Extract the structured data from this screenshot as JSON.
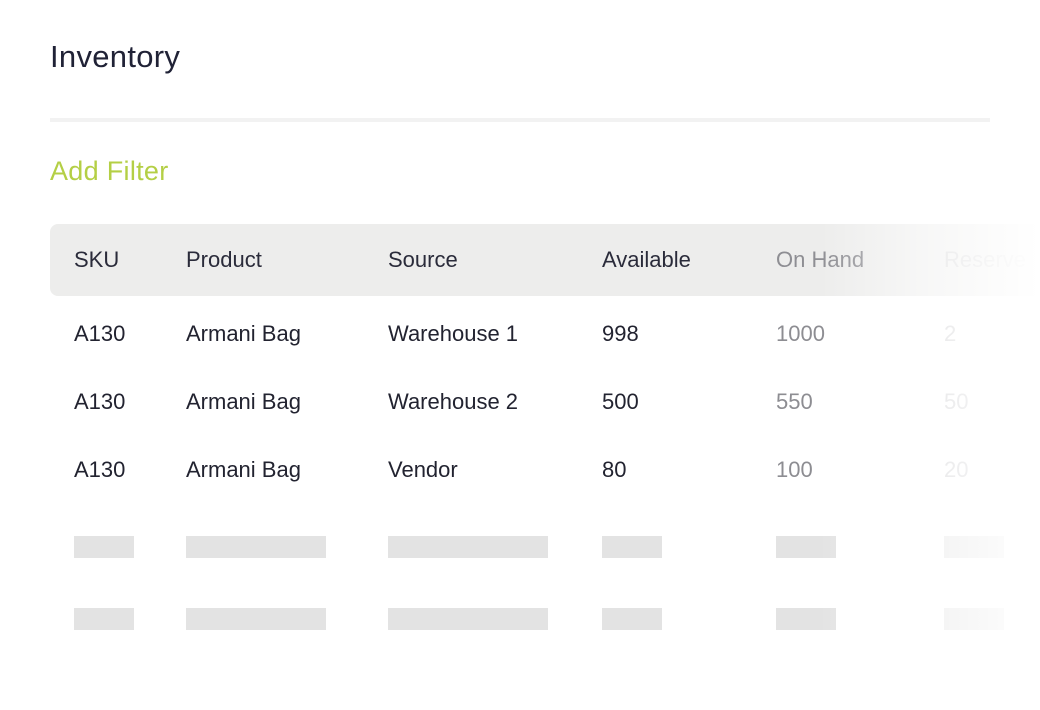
{
  "header": {
    "title": "Inventory"
  },
  "filters": {
    "add_filter_label": "Add Filter"
  },
  "colors": {
    "accent": "#b4cf45",
    "header_bg": "#ededec",
    "skeleton": "#e3e3e3"
  },
  "table": {
    "columns": [
      "SKU",
      "Product",
      "Source",
      "Available",
      "On Hand",
      "Reserve"
    ],
    "rows": [
      {
        "sku": "A130",
        "product": "Armani Bag",
        "source": "Warehouse 1",
        "available": "998",
        "on_hand": "1000",
        "reserved": "2"
      },
      {
        "sku": "A130",
        "product": "Armani Bag",
        "source": "Warehouse 2",
        "available": "500",
        "on_hand": "550",
        "reserved": "50"
      },
      {
        "sku": "A130",
        "product": "Armani Bag",
        "source": "Vendor",
        "available": "80",
        "on_hand": "100",
        "reserved": "20"
      }
    ],
    "loading_rows": 2
  }
}
